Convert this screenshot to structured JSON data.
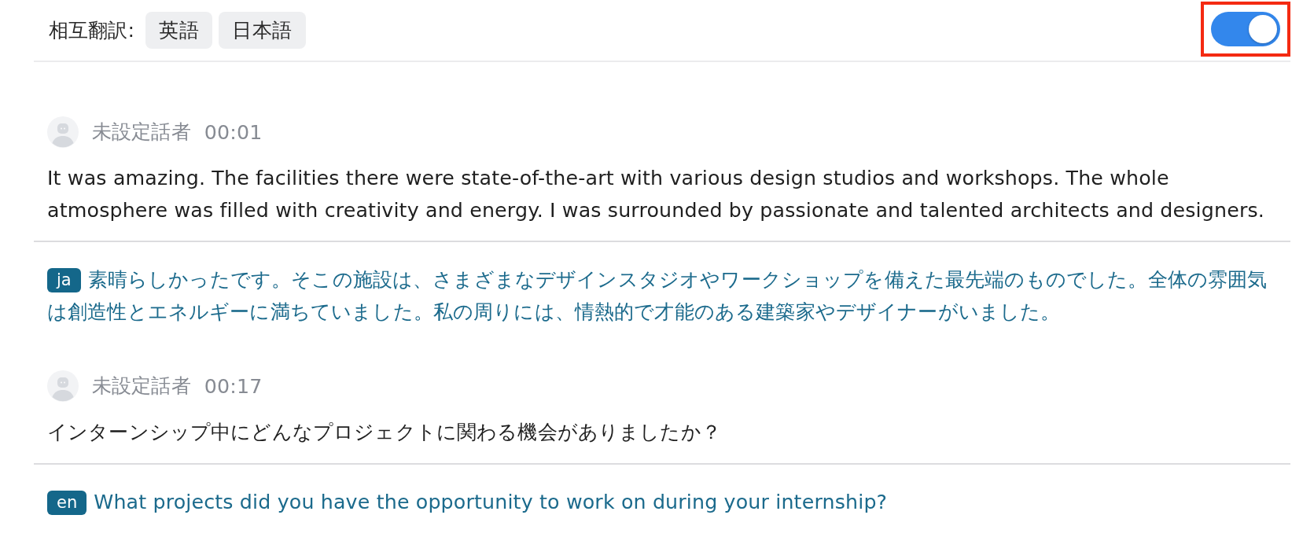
{
  "header": {
    "label": "相互翻訳:",
    "languages": [
      {
        "label": "英語"
      },
      {
        "label": "日本語"
      }
    ]
  },
  "translation_toggle": {
    "on": true,
    "highlighted": true
  },
  "segments": [
    {
      "speaker": "未設定話者",
      "time": "00:01",
      "text": "It was amazing. The facilities there were state-of-the-art with various design studios and workshops. The whole atmosphere was filled with creativity and energy. I was surrounded by passionate and talented architects and designers.",
      "translation": {
        "lang": "ja",
        "text": "素晴らしかったです。そこの施設は、さまざまなデザインスタジオやワークショップを備えた最先端のものでした。全体の雰囲気は創造性とエネルギーに満ちていました。私の周りには、情熱的で才能のある建築家やデザイナーがいました。"
      }
    },
    {
      "speaker": "未設定話者",
      "time": "00:17",
      "text": "インターンシップ中にどんなプロジェクトに関わる機会がありましたか？",
      "translation": {
        "lang": "en",
        "text": "What projects did you have the opportunity to work on during your internship?"
      }
    }
  ]
}
